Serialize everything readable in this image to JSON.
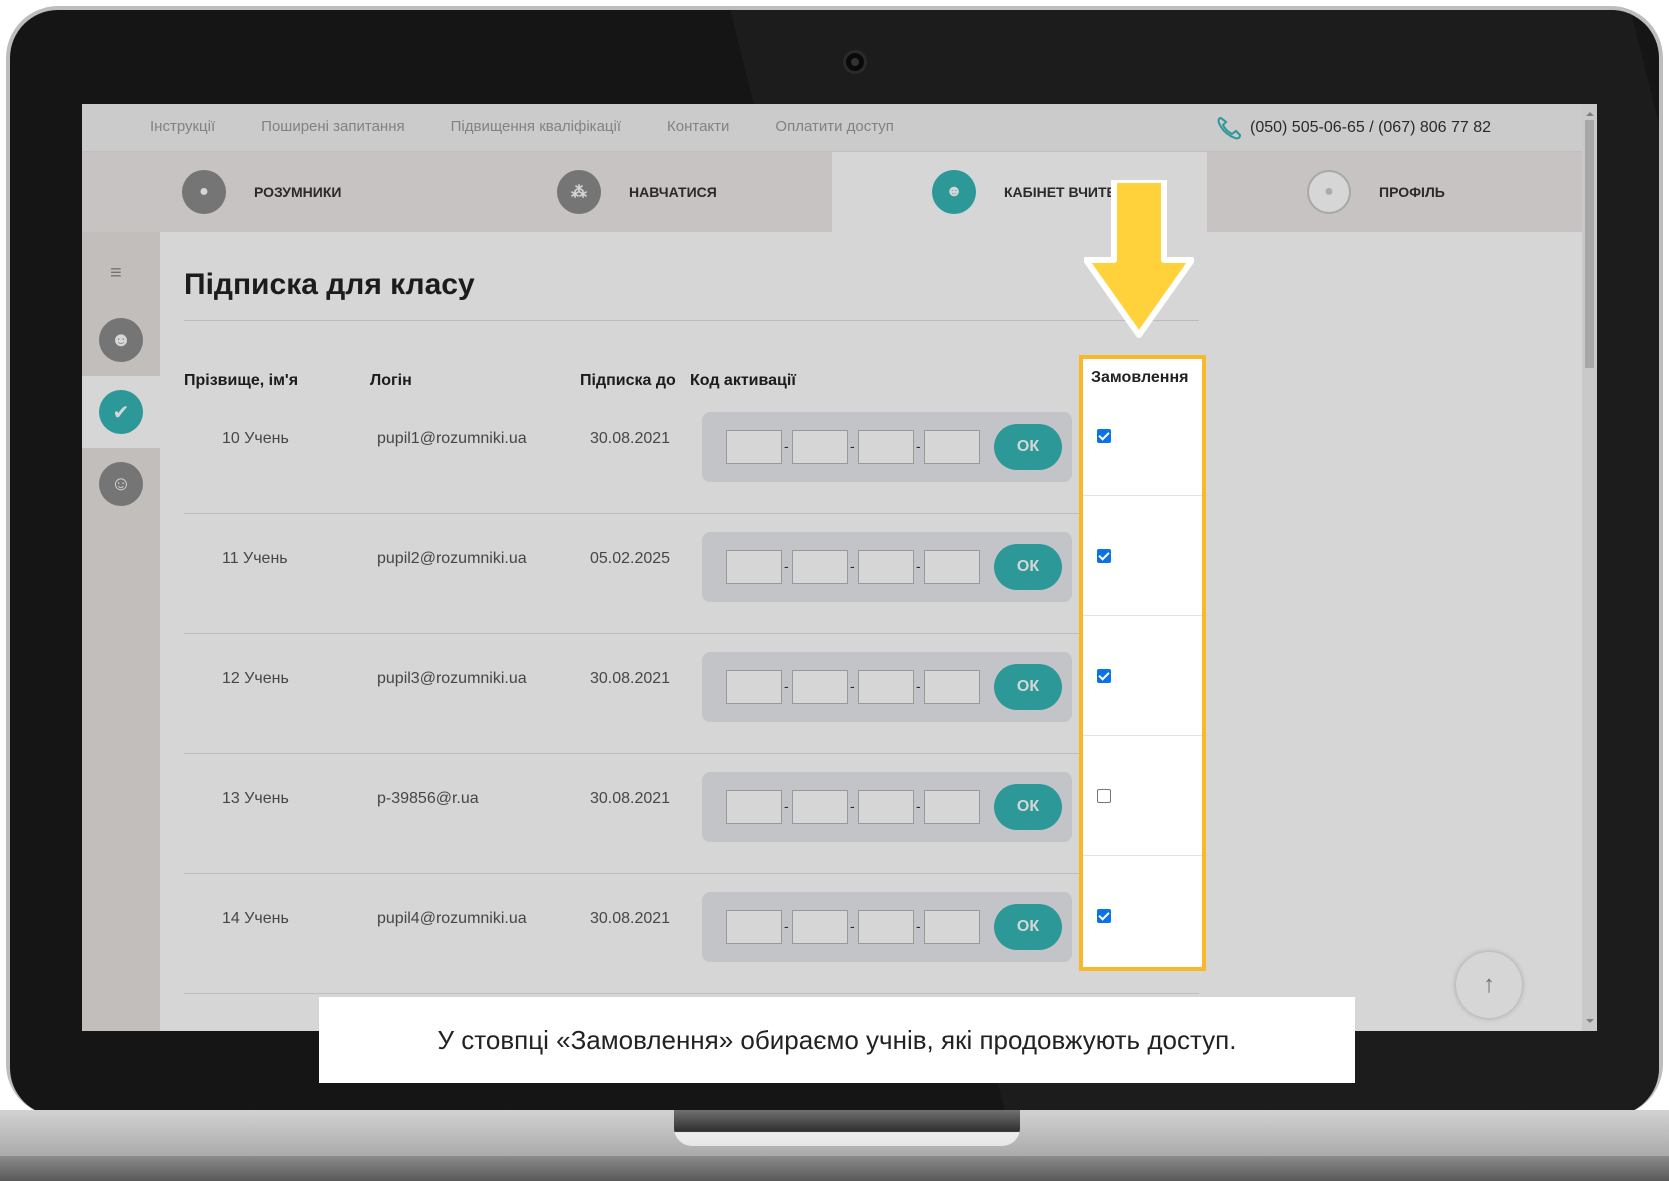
{
  "top_nav": [
    "Інструкції",
    "Поширені запитання",
    "Підвищення кваліфікації",
    "Контакти",
    "Оплатити доступ"
  ],
  "phone": "(050) 505-06-65 / (067) 806 77 82",
  "main_nav": [
    {
      "label": "РОЗУМНИКИ",
      "icon": "owl-icon"
    },
    {
      "label": "НАВЧАТИСЯ",
      "icon": "shapes-icon"
    },
    {
      "label": "КАБІНЕТ ВЧИТЕЛЯ",
      "icon": "teacher-icon",
      "active": true
    },
    {
      "label": "ПРОФІЛЬ",
      "icon": "avatar-icon"
    }
  ],
  "sidebar_icons": [
    "hamburger-menu-icon",
    "teacher-icon",
    "check-icon",
    "smile-icon"
  ],
  "page_title": "Підписка для класу",
  "table": {
    "headers": [
      "Прізвище, ім'я",
      "Логін",
      "Підписка до",
      "Код активації"
    ],
    "order_header": "Замовлення",
    "rows": [
      {
        "name": "10 Учень",
        "login": "pupil1@rozumniki.ua",
        "until": "30.08.2021",
        "order": true
      },
      {
        "name": "11 Учень",
        "login": "pupil2@rozumniki.ua",
        "until": "05.02.2025",
        "order": true
      },
      {
        "name": "12 Учень",
        "login": "pupil3@rozumniki.ua",
        "until": "30.08.2021",
        "order": true
      },
      {
        "name": "13 Учень",
        "login": "p-39856@r.ua",
        "until": "30.08.2021",
        "order": false
      },
      {
        "name": "14 Учень",
        "login": "pupil4@rozumniki.ua",
        "until": "30.08.2021",
        "order": true
      }
    ]
  },
  "ok_label": "ОК",
  "caption": "У стовпці «Замовлення» обираємо учнів, які продовжують доступ.",
  "colors": {
    "accent": "#35b7b5",
    "highlight": "#f7b82a",
    "arrow": "#ffd23c",
    "checkbox": "#0b73e7",
    "chat": "#1a87c8"
  }
}
